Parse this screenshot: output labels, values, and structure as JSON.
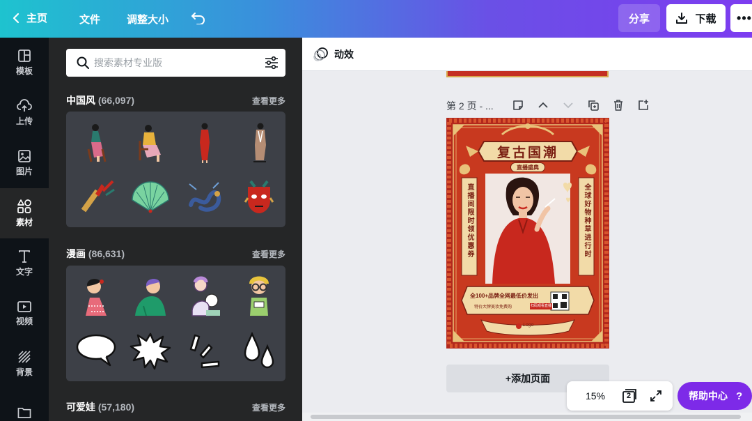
{
  "header": {
    "home_label": "主页",
    "file_label": "文件",
    "resize_label": "调整大小",
    "share_label": "分享",
    "download_label": "下载",
    "more_label": "•••"
  },
  "rail": {
    "items": [
      {
        "label": "模板"
      },
      {
        "label": "上传"
      },
      {
        "label": "图片"
      },
      {
        "label": "素材"
      },
      {
        "label": "文字"
      },
      {
        "label": "视频"
      },
      {
        "label": "背景"
      }
    ]
  },
  "panel": {
    "search_placeholder": "搜索素材专业版",
    "sections": [
      {
        "title": "中国风",
        "count": "(66,097)",
        "more": "查看更多"
      },
      {
        "title": "漫画",
        "count": "(86,631)",
        "more": "查看更多"
      },
      {
        "title": "可爱娃",
        "count": "(57,180)",
        "more": "查看更多"
      }
    ]
  },
  "editor": {
    "animation_label": "动效",
    "page_label": "第 2 页 - ...",
    "add_page_label": "+添加页面",
    "zoom": "15%",
    "page_count": "2",
    "help_label": "帮助中心",
    "help_icon": "?"
  },
  "poster": {
    "title": "复古国潮",
    "subtitle": "直播盛典",
    "left_vertical": "直播间限时领优惠券",
    "right_vertical": "全球好物种草进行时",
    "promo_line1": "全100+品牌全网最低价发出",
    "promo_line2": "特价大牌美妆免费购",
    "promo_tag": "扫码观看直播",
    "brand": "Logo"
  },
  "colors": {
    "accent": "#7d2ae8",
    "rail_bg": "#0e1318",
    "panel_bg": "#252627",
    "poster_red": "#b3281c",
    "poster_gold": "#e9c27a"
  }
}
